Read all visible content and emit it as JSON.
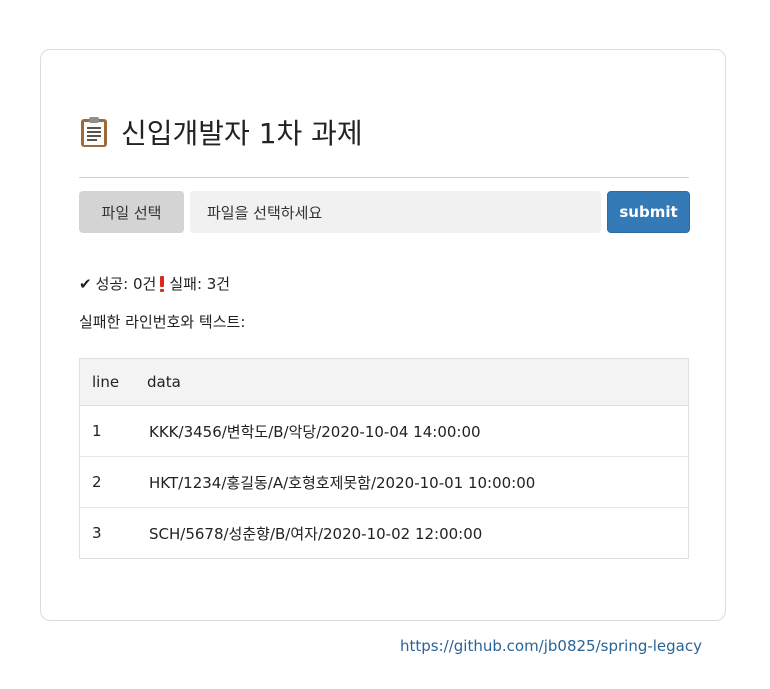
{
  "title": "신입개발자 1차 과제",
  "title_icon": "clipboard-icon",
  "upload": {
    "file_button_label": "파일 선택",
    "file_placeholder": "파일을 선택하세요",
    "submit_label": "submit"
  },
  "summary": {
    "success_label": "성공: 0건",
    "fail_label": "실패: 3건"
  },
  "fail_list_label": "실패한 라인번호와 텍스트:",
  "table": {
    "columns": [
      "line",
      "data"
    ],
    "rows": [
      {
        "line": "1",
        "data": "KKK/3456/변학도/B/악당/2020-10-04 14:00:00"
      },
      {
        "line": "2",
        "data": "HKT/1234/홍길동/A/호형호제못함/2020-10-01 10:00:00"
      },
      {
        "line": "3",
        "data": "SCH/5678/성춘향/B/여자/2020-10-02 12:00:00"
      }
    ]
  },
  "footer_link": "https://github.com/jb0825/spring-legacy",
  "colors": {
    "submit_bg": "#337ab7",
    "link": "#2a6496",
    "error": "#d9291c"
  }
}
